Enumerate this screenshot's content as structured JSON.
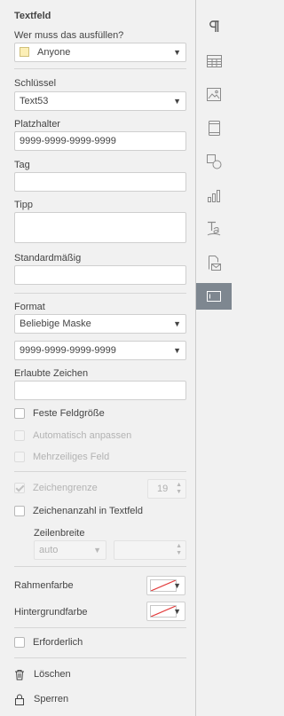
{
  "panel": {
    "title": "Textfeld",
    "who_label": "Wer muss das ausfüllen?",
    "who_value": "Anyone",
    "who_swatch_color": "#fcefb6",
    "key_label": "Schlüssel",
    "key_value": "Text53",
    "placeholder_label": "Platzhalter",
    "placeholder_value": "9999-9999-9999-9999",
    "tag_label": "Tag",
    "tag_value": "",
    "tip_label": "Tipp",
    "tip_value": "",
    "default_label": "Standardmäßig",
    "default_value": "",
    "format_label": "Format",
    "format_value": "Beliebige Maske",
    "mask_value": "9999-9999-9999-9999",
    "allowed_chars_label": "Erlaubte Zeichen",
    "allowed_chars_value": "",
    "fixed_size_label": "Feste Feldgröße",
    "fixed_size_checked": false,
    "auto_fit_label": "Automatisch anpassen",
    "auto_fit_enabled": false,
    "multiline_label": "Mehrzeiliges Feld",
    "multiline_enabled": false,
    "char_limit_label": "Zeichengrenze",
    "char_limit_checked": true,
    "char_limit_enabled": false,
    "char_limit_value": "19",
    "comb_label": "Zeichenanzahl in Textfeld",
    "comb_checked": false,
    "cell_width_label": "Zeilenbreite",
    "cell_width_mode": "auto",
    "cell_width_value": "",
    "border_color_label": "Rahmenfarbe",
    "border_color_value": "none",
    "fill_color_label": "Hintergrundfarbe",
    "fill_color_value": "none",
    "required_label": "Erforderlich",
    "required_checked": false,
    "delete_label": "Löschen",
    "lock_label": "Sperren"
  },
  "right_toolbar": {
    "items": [
      {
        "icon": "paragraph-icon"
      },
      {
        "icon": "table-icon"
      },
      {
        "icon": "image-icon"
      },
      {
        "icon": "header-footer-icon"
      },
      {
        "icon": "shape-icon"
      },
      {
        "icon": "chart-icon"
      },
      {
        "icon": "text-art-icon"
      },
      {
        "icon": "mail-merge-icon"
      },
      {
        "icon": "form-icon",
        "active": true
      }
    ],
    "active_color": "#7e8790"
  }
}
